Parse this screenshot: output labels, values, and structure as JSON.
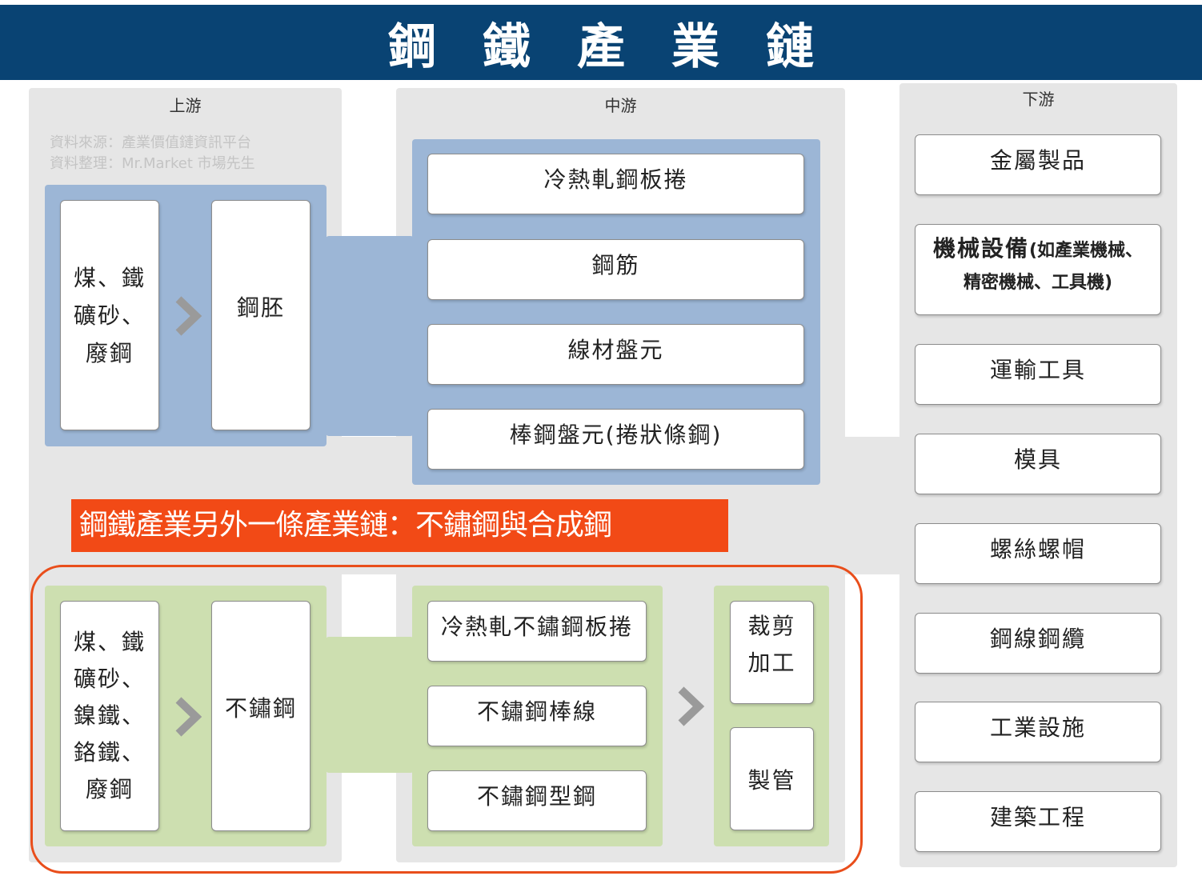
{
  "header": {
    "title": "鋼鐵產業鏈"
  },
  "columns": {
    "upstream": "上游",
    "midstream": "中游",
    "downstream": "下游"
  },
  "source_note": {
    "line1": "資料來源：產業價值鏈資訊平台",
    "line2": "資料整理：Mr.Market 市場先生"
  },
  "steel_chain": {
    "raw_materials": [
      "煤、鐵",
      "礦砂、",
      "廢鋼"
    ],
    "billet": "鋼胚",
    "midstream_products": [
      "冷熱軋鋼板捲",
      "鋼筋",
      "線材盤元",
      "棒鋼盤元(捲狀條鋼)"
    ]
  },
  "downstream": {
    "items": [
      "金屬製品",
      "運輸工具",
      "模具",
      "螺絲螺帽",
      "鋼線鋼纜",
      "工業設施",
      "建築工程"
    ],
    "machinery_main": "機械設備",
    "machinery_note_1": "(如產業機械、",
    "machinery_note_2": "精密機械、工具機)"
  },
  "callout": {
    "text": "鋼鐵產業另外一條產業鏈：不鏽鋼與合成鋼"
  },
  "stainless_chain": {
    "raw_materials": [
      "煤、鐵",
      "礦砂、",
      "鎳鐵、",
      "鉻鐵、",
      "廢鋼"
    ],
    "stainless": "不鏽鋼",
    "midstream_products": [
      "冷熱軋不鏽鋼板捲",
      "不鏽鋼棒線",
      "不鏽鋼型鋼"
    ],
    "processing": {
      "cutting_1": "裁剪",
      "cutting_2": "加工",
      "pipe": "製管"
    }
  },
  "colors": {
    "header_bg": "#094373",
    "column_bg": "#e6e6e6",
    "blue_panel": "#9cb6d6",
    "green_panel": "#cddfb0",
    "callout_bg": "#f24a16",
    "outline": "#e94e1b",
    "arrow": "#9a9a9a"
  }
}
